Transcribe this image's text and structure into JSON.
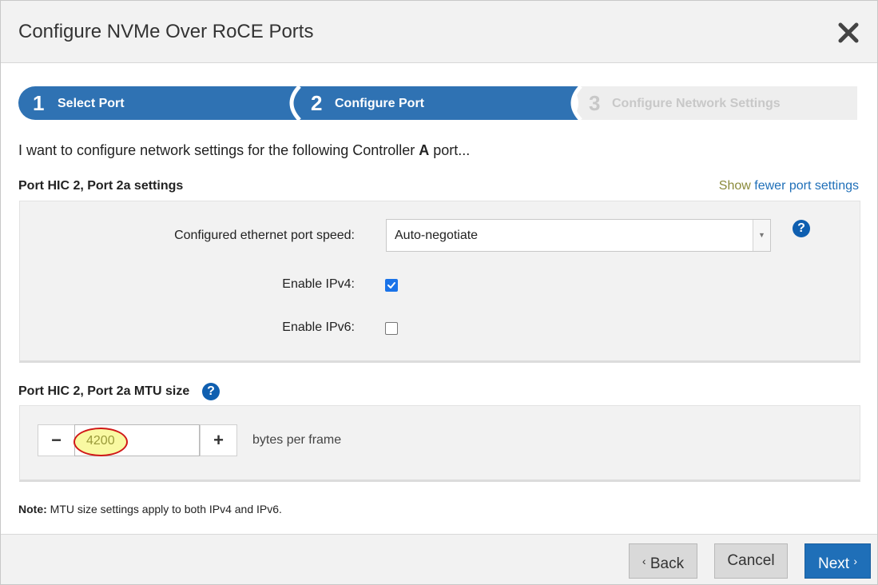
{
  "dialog": {
    "title": "Configure NVMe Over RoCE Ports"
  },
  "wizard": {
    "steps": [
      {
        "number": "1",
        "label": "Select Port",
        "state": "complete"
      },
      {
        "number": "2",
        "label": "Configure Port",
        "state": "active"
      },
      {
        "number": "3",
        "label": "Configure Network Settings",
        "state": "inactive"
      }
    ],
    "colors": {
      "active": "#2f72b3",
      "inactive": "#eeeeee",
      "inactive_text": "#c8c8c8"
    }
  },
  "intro": {
    "prefix": "I want to configure network settings for the following Controller ",
    "controller": "A",
    "suffix": " port..."
  },
  "port_settings": {
    "title": "Port HIC 2, Port 2a settings",
    "toggle_link_highlight": "Show",
    "toggle_link_rest": " fewer port settings",
    "speed_label": "Configured ethernet port speed:",
    "speed_value": "Auto-negotiate",
    "ipv4_label": "Enable IPv4:",
    "ipv4_checked": true,
    "ipv6_label": "Enable IPv6:",
    "ipv6_checked": false
  },
  "mtu": {
    "title": "Port HIC 2, Port 2a MTU size",
    "value": "4200",
    "unit": "bytes per frame",
    "minus": "−",
    "plus": "+"
  },
  "note": {
    "label": "Note:",
    "text": " MTU size settings apply to both IPv4 and IPv6."
  },
  "footer": {
    "back": "Back",
    "cancel": "Cancel",
    "next": "Next"
  },
  "help_glyph": "?"
}
